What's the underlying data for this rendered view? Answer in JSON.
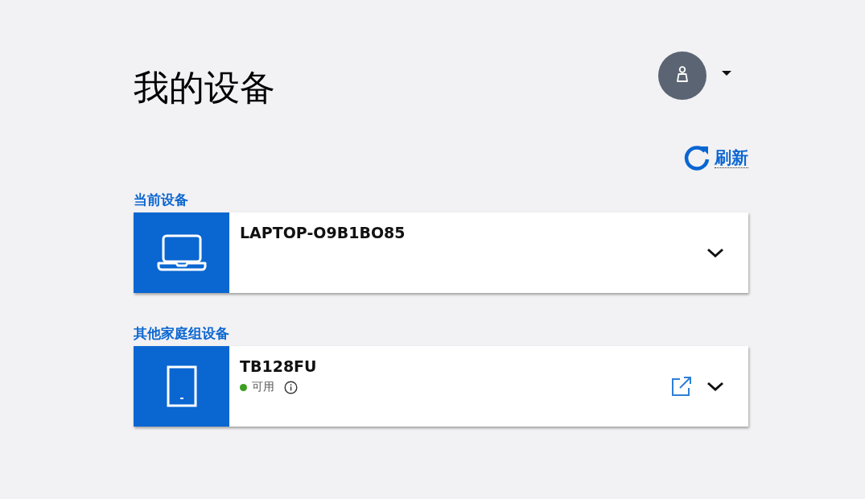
{
  "title": "我的设备",
  "refresh": {
    "label": "刷新"
  },
  "sections": [
    {
      "heading": "当前设备",
      "devices": [
        {
          "kind": "laptop",
          "name": "LAPTOP-O9B1BO85",
          "open_link": false
        }
      ]
    },
    {
      "heading": "其他家庭组设备",
      "devices": [
        {
          "kind": "tablet",
          "name": "TB128FU",
          "status": {
            "label": "可用",
            "color": "#3c9e1f"
          },
          "open_link": true
        }
      ]
    }
  ]
}
